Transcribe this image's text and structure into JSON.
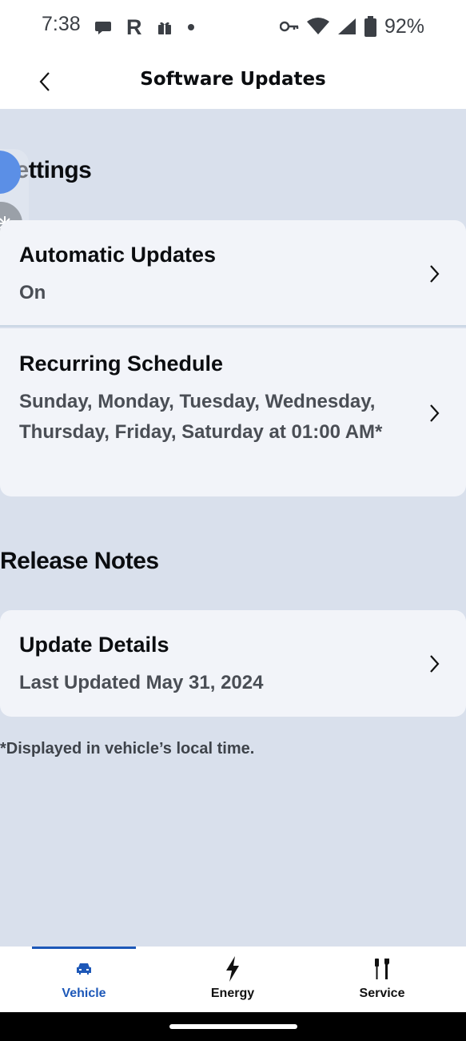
{
  "status_bar": {
    "time": "7:38",
    "left_icons": [
      "chat-bubble-icon",
      "r-app-icon",
      "gift-icon",
      "dot-icon"
    ],
    "r_glyph": "R",
    "right_icons": [
      "key-icon",
      "wifi-icon",
      "cell-signal-icon",
      "battery-icon"
    ],
    "battery": "92%"
  },
  "header": {
    "title": "Software Updates"
  },
  "settings_section": {
    "heading": "Settings",
    "items": [
      {
        "title": "Automatic Updates",
        "subtitle": "On"
      },
      {
        "title": "Recurring Schedule",
        "subtitle": "Sunday, Monday, Tuesday, Wednesday, Thursday, Friday, Saturday at 01:00 AM*"
      }
    ]
  },
  "release_section": {
    "heading": "Release Notes",
    "items": [
      {
        "title": "Update Details",
        "subtitle": "Last Updated May 31, 2024"
      }
    ]
  },
  "footnote": "*Displayed in vehicle’s local time.",
  "bottom_nav": {
    "active": "Vehicle",
    "items": [
      {
        "label": "Vehicle",
        "icon": "car-icon"
      },
      {
        "label": "Energy",
        "icon": "lightning-icon"
      },
      {
        "label": "Service",
        "icon": "tools-icon"
      }
    ]
  },
  "colors": {
    "background": "#d9e0ec",
    "card": "#f2f4f9",
    "accent": "#1d58b8"
  }
}
